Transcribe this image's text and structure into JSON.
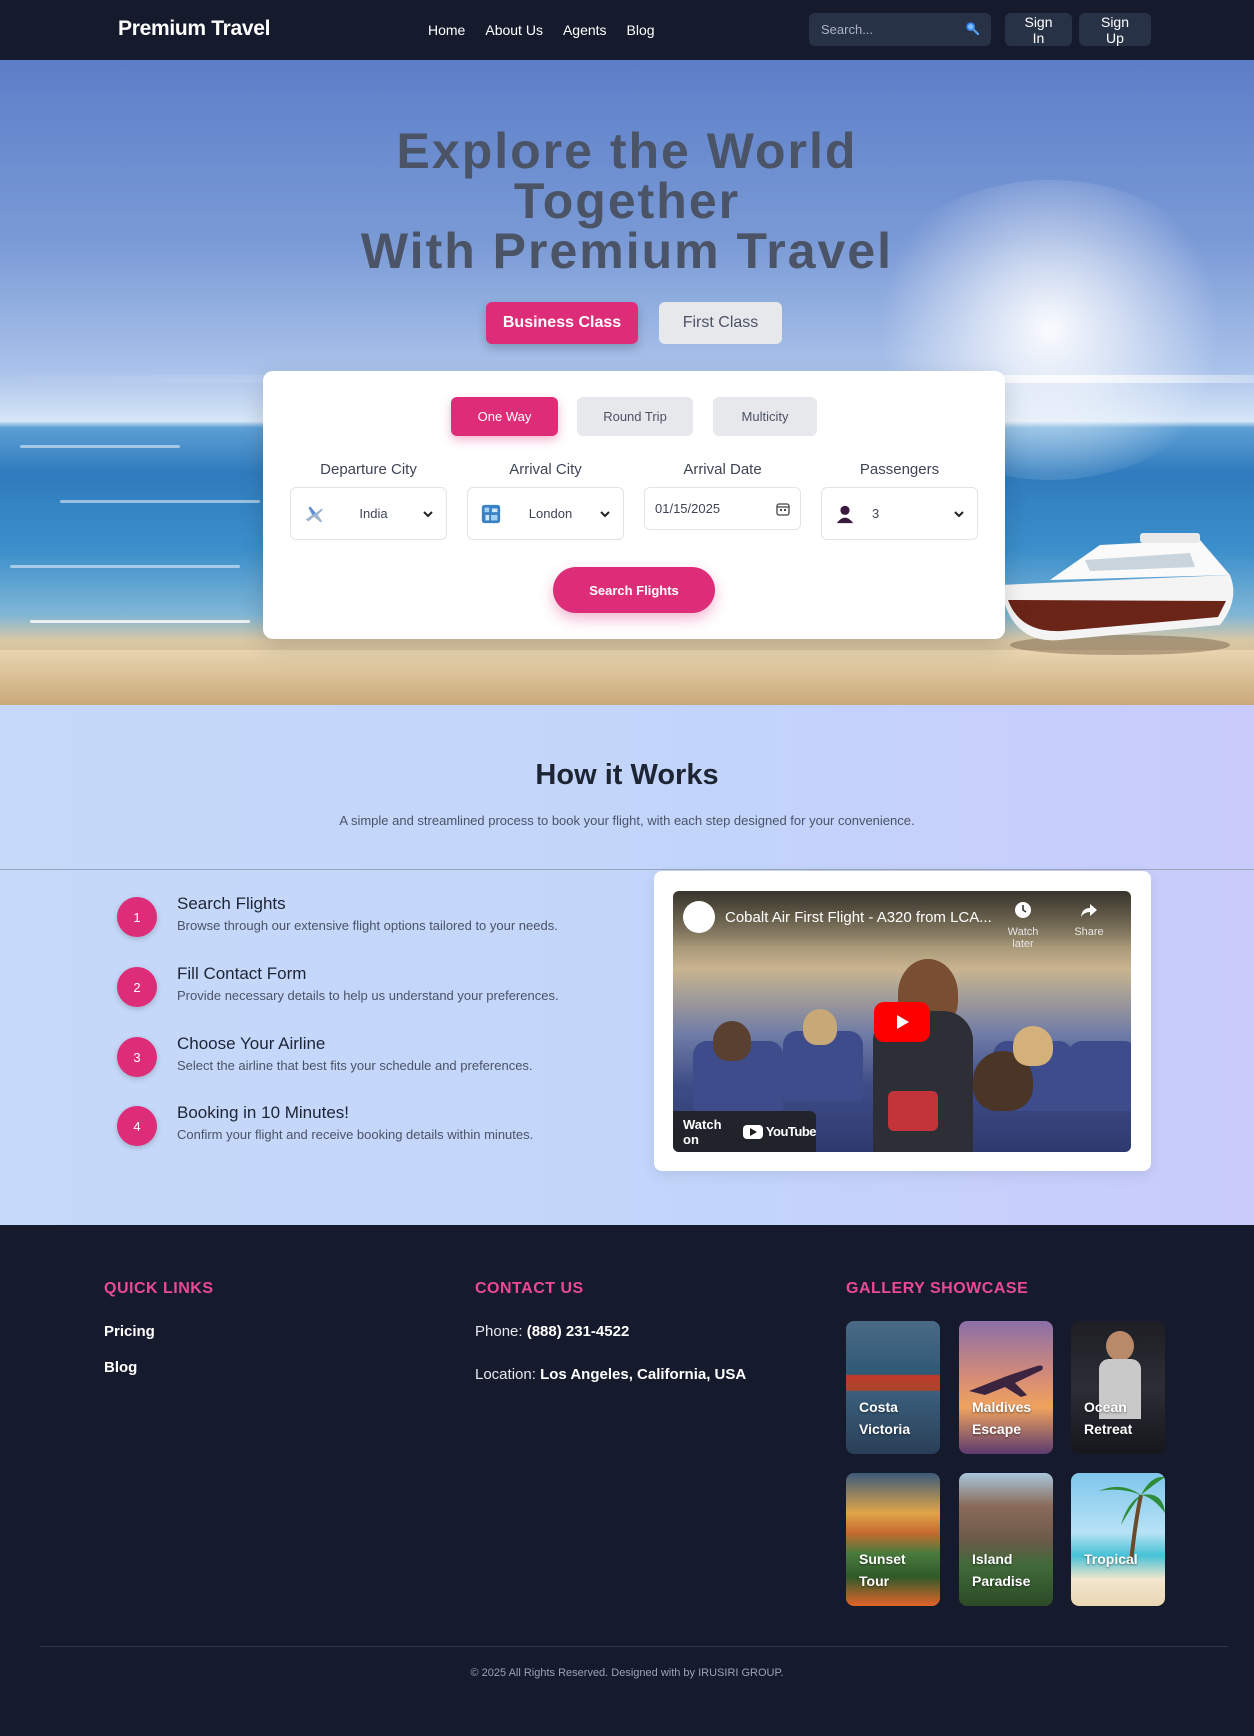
{
  "nav": {
    "brand": "Premium Travel",
    "links": [
      "Home",
      "About Us",
      "Agents",
      "Blog"
    ],
    "search_placeholder": "Search...",
    "sign_in": "Sign In",
    "sign_up": "Sign Up"
  },
  "hero": {
    "title_line1": "Explore the World",
    "title_line2": "Together",
    "title_line3": "With Premium Travel",
    "class_business": "Business Class",
    "class_first": "First Class"
  },
  "booking": {
    "tabs": [
      "One Way",
      "Round Trip",
      "Multicity"
    ],
    "departure_label": "Departure City",
    "departure_value": "India",
    "arrival_label": "Arrival City",
    "arrival_value": "London",
    "date_label": "Arrival Date",
    "date_value": "01/15/2025",
    "passengers_label": "Passengers",
    "passengers_value": "3",
    "search_button": "Search Flights"
  },
  "how": {
    "title": "How it Works",
    "subtitle": "A simple and streamlined process to book your flight, with each step designed for your convenience.",
    "steps": [
      {
        "num": "1",
        "title": "Search Flights",
        "desc": "Browse through our extensive flight options tailored to your needs."
      },
      {
        "num": "2",
        "title": "Fill Contact Form",
        "desc": "Provide necessary details to help us understand your preferences."
      },
      {
        "num": "3",
        "title": "Choose Your Airline",
        "desc": "Select the airline that best fits your schedule and preferences."
      },
      {
        "num": "4",
        "title": "Booking in 10 Minutes!",
        "desc": "Confirm your flight and receive booking details within minutes."
      }
    ],
    "video": {
      "title": "Cobalt Air First Flight - A320 from LCA...",
      "watch_later": "Watch later",
      "share": "Share",
      "watch_on": "Watch on",
      "youtube": "YouTube"
    }
  },
  "footer": {
    "quick_links_title": "QUICK LINKS",
    "quick_links": [
      "Pricing",
      "Blog"
    ],
    "contact_title": "CONTACT US",
    "phone_label": "Phone:",
    "phone_value": "(888) 231-4522",
    "location_label": "Location:",
    "location_value": "Los Angeles, California, USA",
    "gallery_title": "GALLERY SHOWCASE",
    "gallery": [
      "Costa Victoria",
      "Maldives Escape",
      "Ocean Retreat",
      "Sunset Tour",
      "Island Paradise",
      "Tropical"
    ],
    "copyright": "© 2025 All Rights Reserved. Designed with by IRUSIRI GROUP."
  },
  "colors": {
    "accent": "#dd2d78",
    "footer_heading": "#ec4899",
    "dark_bg": "#151b2c"
  }
}
